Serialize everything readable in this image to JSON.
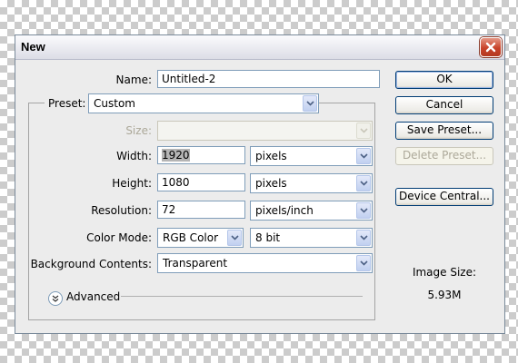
{
  "dialog": {
    "title": "New"
  },
  "name": {
    "label": "Name:",
    "value": "Untitled-2"
  },
  "preset": {
    "label": "Preset:",
    "value": "Custom"
  },
  "size": {
    "label": "Size:",
    "value": ""
  },
  "width": {
    "label": "Width:",
    "value": "1920",
    "unit": "pixels"
  },
  "height": {
    "label": "Height:",
    "value": "1080",
    "unit": "pixels"
  },
  "resolution": {
    "label": "Resolution:",
    "value": "72",
    "unit": "pixels/inch"
  },
  "color_mode": {
    "label": "Color Mode:",
    "mode": "RGB Color",
    "depth": "8 bit"
  },
  "background": {
    "label": "Background Contents:",
    "value": "Transparent"
  },
  "advanced": {
    "label": "Advanced"
  },
  "buttons": {
    "ok": "OK",
    "cancel": "Cancel",
    "save_preset": "Save Preset...",
    "delete_preset": "Delete Preset...",
    "device_central": "Device Central..."
  },
  "image_size": {
    "label": "Image Size:",
    "value": "5.93M"
  },
  "icons": {
    "close": "close-icon",
    "dropdown": "chevron-down-icon",
    "advanced": "double-chevron-down-icon"
  },
  "colors": {
    "close_button": "#c8432a",
    "button_border": "#003c74",
    "input_border": "#7f9db9"
  }
}
